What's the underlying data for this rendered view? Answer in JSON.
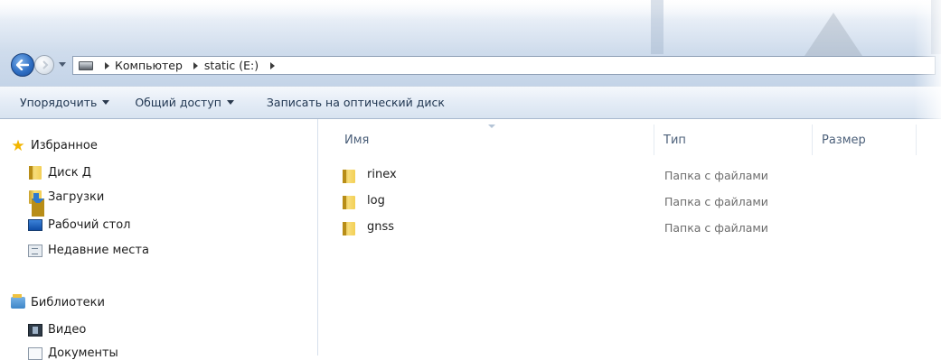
{
  "navigation": {
    "back_icon": "back-arrow-icon",
    "forward_icon": "forward-arrow-icon",
    "history_dropdown_icon": "chevron-down-icon"
  },
  "address": {
    "icon": "drive-icon",
    "crumbs": [
      "Компьютер",
      "static (E:)"
    ]
  },
  "toolbar": {
    "organize_label": "Упорядочить",
    "share_label": "Общий доступ",
    "burn_label": "Записать на оптический диск"
  },
  "sidebar": {
    "favorites": {
      "label": "Избранное",
      "icon": "star-icon",
      "items": [
        {
          "label": "Диск Д",
          "icon": "folder-icon"
        },
        {
          "label": "Загрузки",
          "icon": "downloads-icon"
        },
        {
          "label": "Рабочий стол",
          "icon": "desktop-icon"
        },
        {
          "label": "Недавние места",
          "icon": "recent-places-icon"
        }
      ]
    },
    "libraries": {
      "label": "Библиотеки",
      "icon": "libraries-icon",
      "items": [
        {
          "label": "Видео",
          "icon": "video-icon"
        },
        {
          "label": "Документы",
          "icon": "documents-icon"
        }
      ]
    }
  },
  "content": {
    "columns": {
      "name": "Имя",
      "type": "Тип",
      "size": "Размер"
    },
    "files": [
      {
        "name": "rinex",
        "type": "Папка с файлами",
        "size": ""
      },
      {
        "name": "log",
        "type": "Папка с файлами",
        "size": ""
      },
      {
        "name": "gnss",
        "type": "Папка с файлами",
        "size": ""
      }
    ]
  },
  "colors": {
    "accent": "#2f6fc4",
    "folder": "#f3cf55",
    "toolbar_bg": "#e4ecf6",
    "header_text": "#4c607a"
  }
}
